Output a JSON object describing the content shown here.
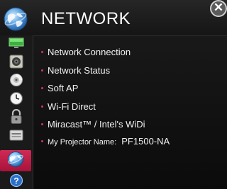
{
  "header": {
    "title": "NETWORK",
    "icon": "globe-icon",
    "close_icon": "close-icon"
  },
  "sidebar": {
    "items": [
      {
        "icon": "picture-icon",
        "active": false
      },
      {
        "icon": "speaker-icon",
        "active": false
      },
      {
        "icon": "disc-icon",
        "active": false
      },
      {
        "icon": "clock-icon",
        "active": false
      },
      {
        "icon": "lock-icon",
        "active": false
      },
      {
        "icon": "option-icon",
        "active": false
      },
      {
        "icon": "network-globe-icon",
        "active": true
      },
      {
        "icon": "help-icon",
        "active": false,
        "label": "?"
      }
    ]
  },
  "menu": {
    "items": [
      {
        "label": "Network Connection"
      },
      {
        "label": "Network Status"
      },
      {
        "label": "Soft AP"
      },
      {
        "label": "Wi-Fi Direct"
      },
      {
        "label": "Miracast™ / Intel's WiDi"
      }
    ],
    "projector_name": {
      "label": "My Projector Name:",
      "value": "PF1500-NA"
    }
  },
  "colors": {
    "accent": "#c8204a",
    "background": "#111111",
    "text": "#f2f2f2"
  }
}
